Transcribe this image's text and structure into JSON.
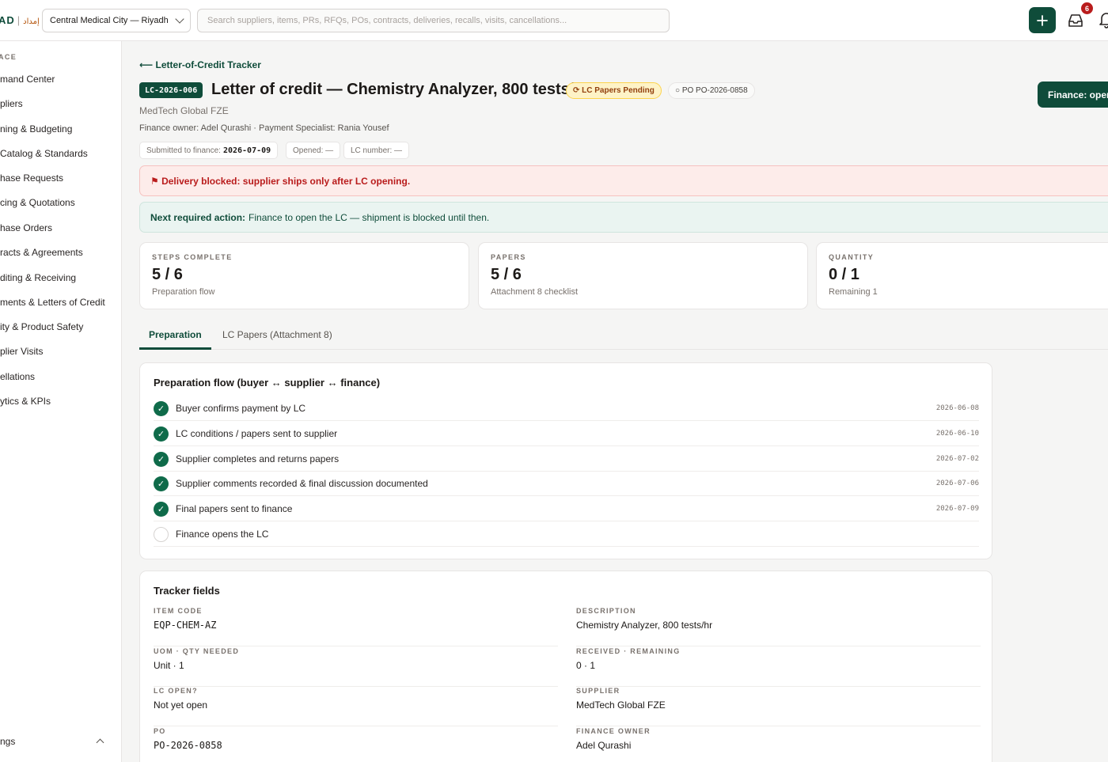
{
  "topbar": {
    "brand": "AD",
    "brand_ar": "إمداد",
    "site": "Central Medical City — Riyadh",
    "search_placeholder": "Search suppliers, items, PRs, RFQs, POs, contracts, deliveries, recalls, visits, cancellations...",
    "inbox_count": "6"
  },
  "sidebar": {
    "section": "ACE",
    "items": [
      "mand Center",
      "pliers",
      "ning & Budgeting",
      " Catalog & Standards",
      "hase Requests",
      "cing & Quotations",
      "hase Orders",
      "racts & Agreements",
      "diting & Receiving",
      "ments & Letters of Credit",
      "ity & Product Safety",
      "plier Visits",
      "ellations",
      "ytics & KPIs"
    ],
    "footer": "ngs"
  },
  "header": {
    "back": "⟵ Letter-of-Credit Tracker",
    "lc_id": "LC-2026-006",
    "title": "Letter of credit — Chemistry Analyzer, 800 tests/hr",
    "status": "⟳ LC Papers Pending",
    "po": "○ PO PO-2026-0858",
    "action": "Finance: open",
    "supplier": "MedTech Global FZE",
    "owners": "Finance owner: Adel Qurashi · Payment Specialist: Rania Yousef",
    "chips": {
      "submitted_label": "Submitted to finance:",
      "submitted_value": "2026-07-09",
      "opened": "Opened: —",
      "lc_number": "LC number: —"
    }
  },
  "alerts": {
    "blocked": "⚑ Delivery blocked: supplier ships only after LC opening.",
    "next_label": "Next required action:",
    "next_text": "Finance to open the LC — shipment is blocked until then."
  },
  "kpis": [
    {
      "label": "STEPS COMPLETE",
      "value": "5 / 6",
      "sub": "Preparation flow"
    },
    {
      "label": "PAPERS",
      "value": "5 / 6",
      "sub": "Attachment 8 checklist"
    },
    {
      "label": "QUANTITY",
      "value": "0 / 1",
      "sub": "Remaining 1"
    }
  ],
  "tabs": [
    "Preparation",
    "LC Papers (Attachment 8)"
  ],
  "flow": {
    "title": "Preparation flow (buyer ↔ supplier ↔ finance)",
    "steps": [
      {
        "label": "Buyer confirms payment by LC",
        "date": "2026-06-08",
        "done": true
      },
      {
        "label": "LC conditions / papers sent to supplier",
        "date": "2026-06-10",
        "done": true
      },
      {
        "label": "Supplier completes and returns papers",
        "date": "2026-07-02",
        "done": true
      },
      {
        "label": "Supplier comments recorded & final discussion documented",
        "date": "2026-07-06",
        "done": true
      },
      {
        "label": "Final papers sent to finance",
        "date": "2026-07-09",
        "done": true
      },
      {
        "label": "Finance opens the LC",
        "date": "",
        "done": false
      }
    ]
  },
  "tracker": {
    "title": "Tracker fields",
    "fields": [
      {
        "label": "ITEM CODE",
        "value": "EQP-CHEM-AZ"
      },
      {
        "label": "DESCRIPTION",
        "value": "Chemistry Analyzer, 800 tests/hr"
      },
      {
        "label": "UOM · QTY NEEDED",
        "value": "Unit · 1"
      },
      {
        "label": "RECEIVED · REMAINING",
        "value": "0 · 1"
      },
      {
        "label": "LC OPEN?",
        "value": "Not yet open"
      },
      {
        "label": "SUPPLIER",
        "value": "MedTech Global FZE"
      },
      {
        "label": "PO",
        "value": "PO-2026-0858"
      },
      {
        "label": "FINANCE OWNER",
        "value": "Adel Qurashi"
      }
    ]
  },
  "colors": {
    "brand": "#0f4c3a",
    "alert_red": "#b91c1c",
    "pending": "#92400e"
  },
  "icons": [
    "plus-icon",
    "inbox-icon",
    "bell-icon",
    "check-icon",
    "chevron-down-icon",
    "chevron-up-icon"
  ]
}
